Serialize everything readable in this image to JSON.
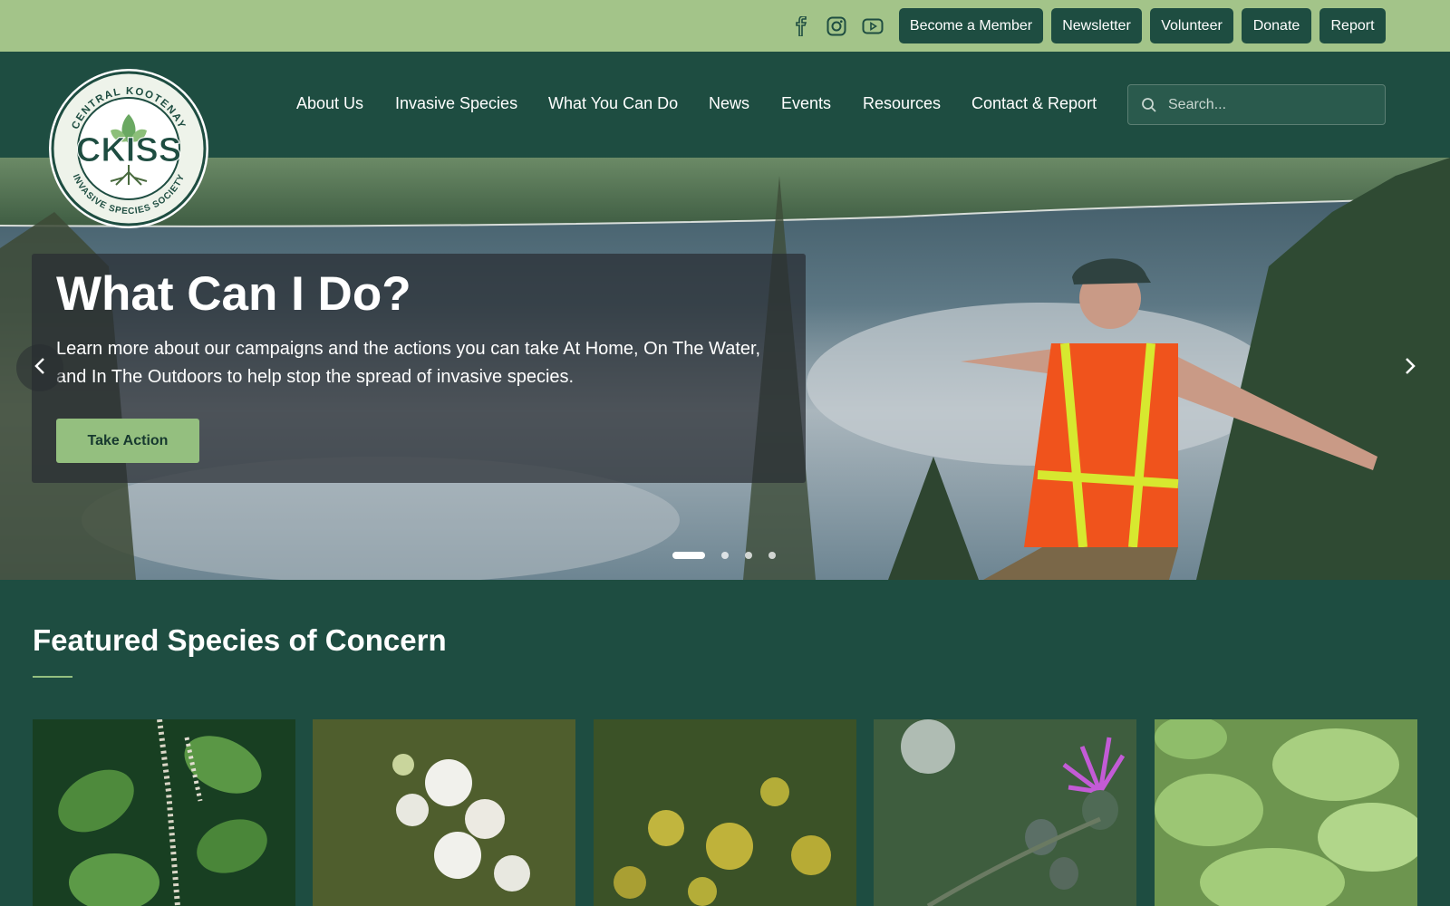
{
  "social": [
    {
      "name": "facebook-icon"
    },
    {
      "name": "instagram-icon"
    },
    {
      "name": "youtube-icon"
    }
  ],
  "top_buttons": {
    "member": "Become a Member",
    "newsletter": "Newsletter",
    "volunteer": "Volunteer",
    "donate": "Donate",
    "report": "Report"
  },
  "logo": {
    "arc_top": "CENTRAL KOOTENAY",
    "initials": "CKISS",
    "arc_bottom": "INVASIVE SPECIES SOCIETY"
  },
  "nav": {
    "about": "About Us",
    "invasive": "Invasive Species",
    "what": "What You Can Do",
    "news": "News",
    "events": "Events",
    "resources": "Resources",
    "contact": "Contact & Report"
  },
  "search": {
    "placeholder": "Search..."
  },
  "hero": {
    "title": "What Can I Do?",
    "text": "Learn more about our campaigns and the actions you can take At Home, On The Water, and In The Outdoors to help stop the spread of invasive species.",
    "cta": "Take Action",
    "slide_count": 4,
    "active_slide": 1
  },
  "featured": {
    "title": "Featured Species of Concern",
    "cards": [
      {
        "name": "knotweed-card"
      },
      {
        "name": "water-hemlock-card"
      },
      {
        "name": "wild-parsnip-card"
      },
      {
        "name": "thistle-card"
      },
      {
        "name": "butterbur-card"
      }
    ]
  },
  "colors": {
    "topbar": "#a3c489",
    "header": "#1e4d41",
    "accent": "#94bf7f"
  }
}
